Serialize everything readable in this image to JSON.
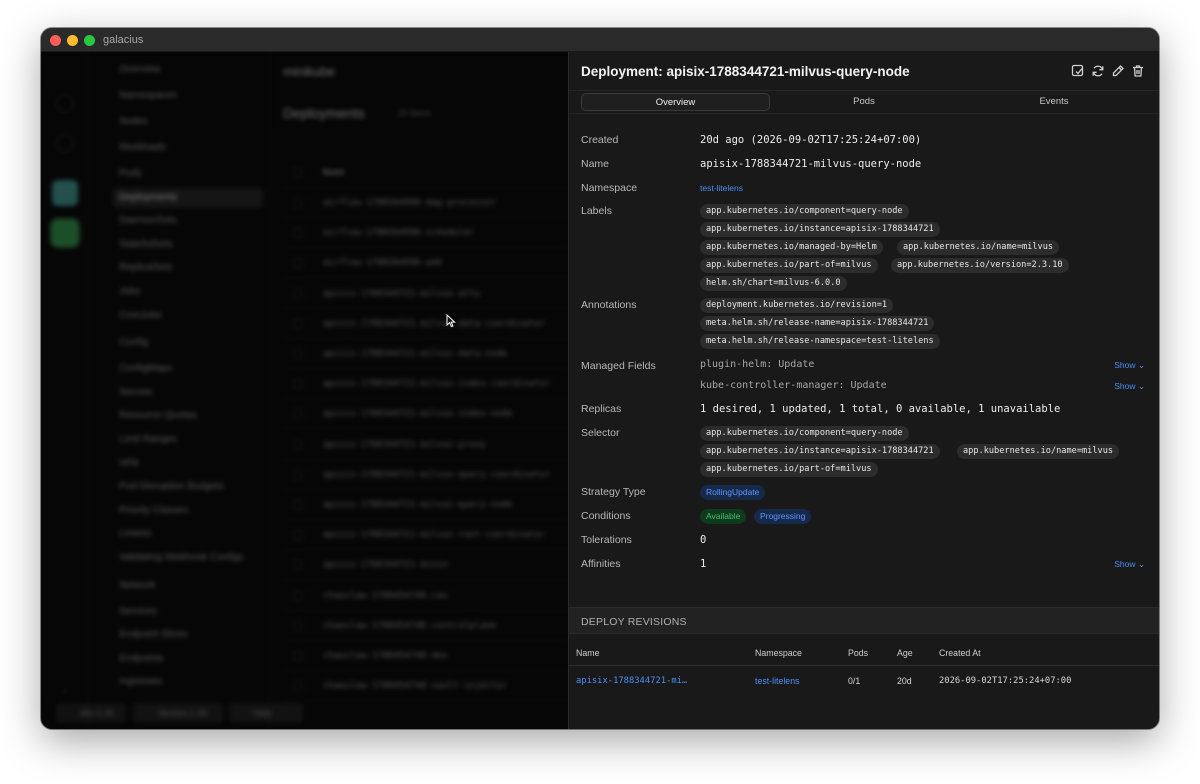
{
  "app": {
    "title": "galacius"
  },
  "background": {
    "cluster": "minikube",
    "list_title": "Deployments",
    "list_count": "19 items",
    "column_name": "Name",
    "nav": {
      "items": [
        {
          "label": "Overview",
          "group": true
        },
        {
          "label": "Namespaces",
          "group": true
        },
        {
          "label": "Nodes",
          "group": true
        },
        {
          "label": "Workloads",
          "group": true
        },
        {
          "label": "Pods"
        },
        {
          "label": "Deployments",
          "selected": true
        },
        {
          "label": "DaemonSets"
        },
        {
          "label": "StatefulSets"
        },
        {
          "label": "ReplicaSets"
        },
        {
          "label": "Jobs"
        },
        {
          "label": "CronJobs"
        },
        {
          "label": "Config",
          "group": true
        },
        {
          "label": "ConfigMaps"
        },
        {
          "label": "Secrets"
        },
        {
          "label": "Resource Quotas"
        },
        {
          "label": "Limit Ranges"
        },
        {
          "label": "HPA"
        },
        {
          "label": "Pod Disruption Budgets"
        },
        {
          "label": "Priority Classes"
        },
        {
          "label": "Leases"
        },
        {
          "label": "Validating Webhook Configs"
        },
        {
          "label": "Network",
          "group": true
        },
        {
          "label": "Services"
        },
        {
          "label": "Endpoint Slices"
        },
        {
          "label": "Endpoints"
        },
        {
          "label": "Ingresses"
        }
      ]
    },
    "rows": [
      "airflow-1788264996-dag-processor",
      "airflow-1788264996-scheduler",
      "airflow-1788264996-web",
      "apisix-1788344721-milvus-attu",
      "apisix-1788344721-milvus-data-coordinator",
      "apisix-1788344721-milvus-data-node",
      "apisix-1788344721-milvus-index-coordinator",
      "apisix-1788344721-milvus-index-node",
      "apisix-1788344721-milvus-proxy",
      "apisix-1788344721-milvus-query-coordinator",
      "apisix-1788344721-milvus-query-node",
      "apisix-1788344721-milvus-root-coordinator",
      "apisix-1788344721-minio",
      "chaoslaw-1788454748-cas",
      "chaoslaw-1788454748-controlplane",
      "chaoslaw-1788454748-dex",
      "chaoslaw-1788454748-vault-injector"
    ],
    "status": [
      "k8s 1.30",
      "Version 1.30",
      "Help"
    ]
  },
  "detail": {
    "title": "Deployment: apisix-1788344721-milvus-query-node",
    "tabs": [
      "Overview",
      "Pods",
      "Events"
    ],
    "active_tab": "Overview",
    "labels": {
      "created": "Created",
      "name": "Name",
      "namespace": "Namespace",
      "labels": "Labels",
      "annotations": "Annotations",
      "managed_fields": "Managed Fields",
      "replicas": "Replicas",
      "selector": "Selector",
      "strategy": "Strategy Type",
      "conditions": "Conditions",
      "tolerations": "Tolerations",
      "affinities": "Affinities"
    },
    "values": {
      "created": "20d ago (2026-09-02T17:25:24+07:00)",
      "name": "apisix-1788344721-milvus-query-node",
      "namespace": "test-litelens",
      "replicas": "1 desired, 1 updated, 1 total, 0 available, 1 unavailable",
      "strategy": "RollingUpdate",
      "tolerations": "0",
      "affinities": "1"
    },
    "labels_chips": [
      "app.kubernetes.io/component=query-node",
      "app.kubernetes.io/instance=apisix-1788344721",
      "app.kubernetes.io/managed-by=Helm",
      "app.kubernetes.io/name=milvus",
      "app.kubernetes.io/part-of=milvus",
      "app.kubernetes.io/version=2.3.10",
      "helm.sh/chart=milvus-6.0.0"
    ],
    "annotations": [
      "deployment.kubernetes.io/revision=1",
      "meta.helm.sh/release-name=apisix-1788344721",
      "meta.helm.sh/release-namespace=test-litelens"
    ],
    "managed_fields": [
      "plugin-helm: Update",
      "kube-controller-manager: Update"
    ],
    "show_label": "Show",
    "selector": [
      "app.kubernetes.io/component=query-node",
      "app.kubernetes.io/instance=apisix-1788344721",
      "app.kubernetes.io/name=milvus",
      "app.kubernetes.io/part-of=milvus"
    ],
    "conditions": [
      "Available",
      "Progressing"
    ],
    "revisions": {
      "title": "DEPLOY REVISIONS",
      "columns": [
        "Name",
        "Namespace",
        "Pods",
        "Age",
        "Created At"
      ],
      "rows": [
        {
          "name": "apisix-1788344721-mi…",
          "namespace": "test-litelens",
          "pods": "0/1",
          "age": "20d",
          "created": "2026-09-02T17:25:24+07:00"
        }
      ]
    },
    "accent": "#4f8ef7"
  }
}
